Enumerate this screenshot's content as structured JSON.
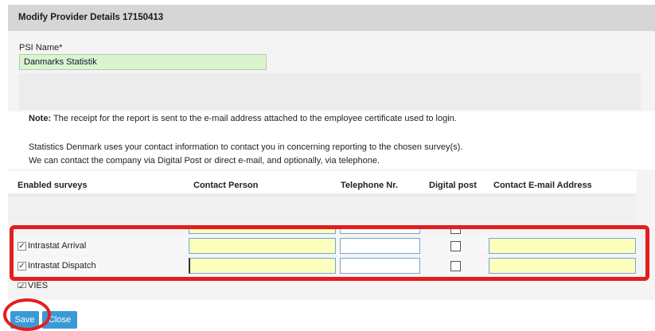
{
  "dialog": {
    "title": "Modify Provider Details 17150413"
  },
  "psi": {
    "label": "PSI Name*",
    "value": "Danmarks Statistik"
  },
  "note": {
    "bold": "Note:",
    "text": " The receipt for the report is sent to the e-mail address attached to the employee certificate used to login.",
    "line1": "Statistics Denmark uses your contact information to contact you in concerning reporting to the chosen survey(s).",
    "line2": "We can contact the company via Digital Post or direct e-mail, and optionally, via telephone."
  },
  "table": {
    "headers": {
      "surveys": "Enabled surveys",
      "contact": "Contact Person",
      "phone": "Telephone Nr.",
      "digital": "Digital post",
      "email": "Contact E-mail Address"
    },
    "rows": [
      {
        "label": "Intrastat Arrival",
        "checked": "✓",
        "contact": "",
        "phone": "",
        "email": ""
      },
      {
        "label": "Intrastat Dispatch",
        "checked": "✓",
        "contact": "",
        "phone": "",
        "email": ""
      },
      {
        "label": "VIES",
        "checked": "✓"
      }
    ]
  },
  "buttons": {
    "save": "Save",
    "close": "Close"
  },
  "colors": {
    "highlight": "#e41d1d",
    "button": "#3a9ad6",
    "input_yellow": "#ffffbd",
    "input_green": "#d9f5cf",
    "titlebar": "#d6d6d6"
  }
}
